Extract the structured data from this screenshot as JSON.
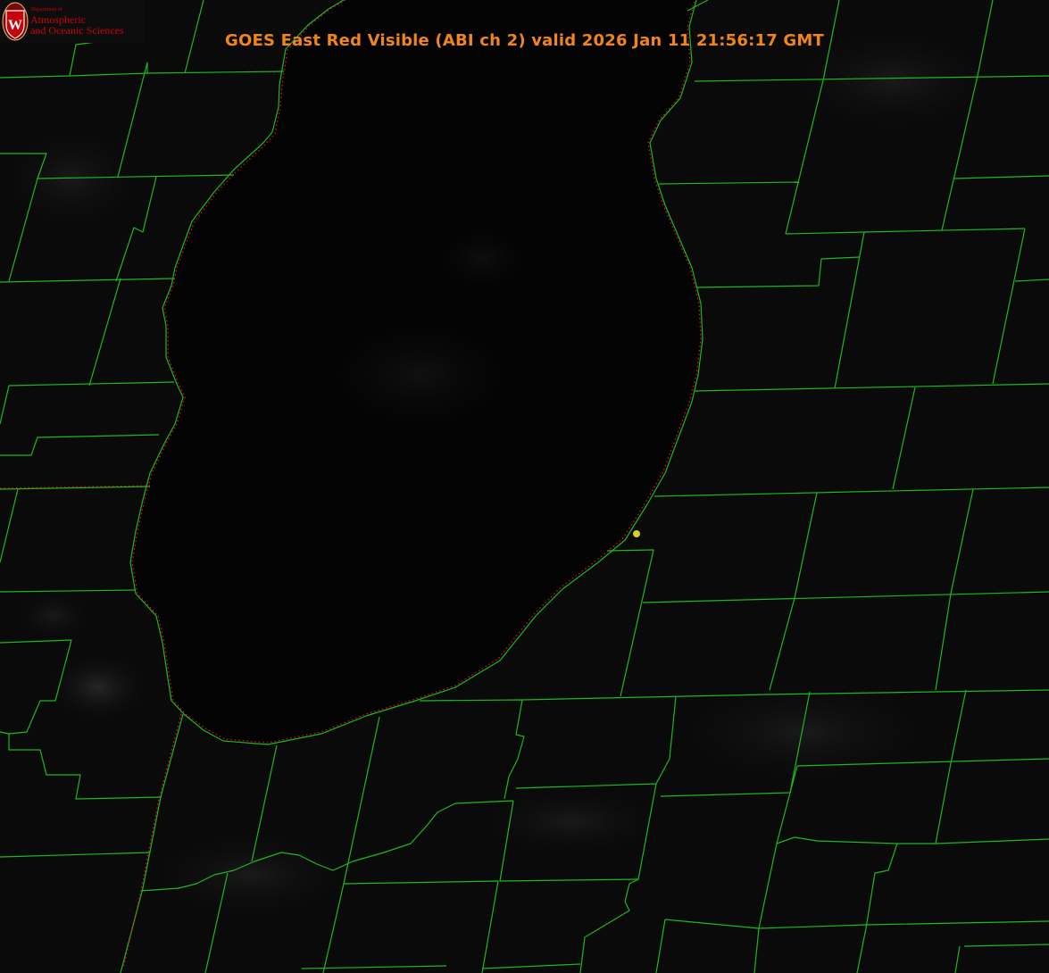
{
  "title": "GOES East Red Visible (ABI ch 2) valid 2026 Jan 11 21:56:17 GMT",
  "logo": {
    "department_label": "Department of",
    "line1": "Atmospheric",
    "line2": "and Oceanic Sciences",
    "shield_letter": "W"
  },
  "colors": {
    "title": "#f0861a",
    "county_lines": "#1db81d",
    "state_border": "#e01515",
    "marker": "#d8d020",
    "logo_red": "#c5050c"
  },
  "icons": {
    "logo": "uw-crest-icon",
    "marker": "location-marker-icon"
  }
}
